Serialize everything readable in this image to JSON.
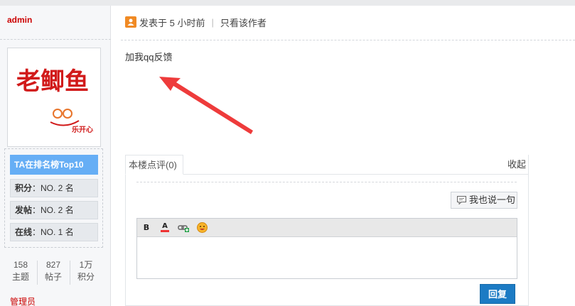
{
  "author": {
    "name": "admin",
    "role": "管理员"
  },
  "avatar": {
    "logo_text": "老鲫鱼",
    "sub_text": "乐开心"
  },
  "rank": {
    "title": "TA在排名榜Top10",
    "rows": [
      {
        "label": "积分",
        "value": "：NO. 2 名"
      },
      {
        "label": "发帖",
        "value": "：NO. 2 名"
      },
      {
        "label": "在线",
        "value": "：NO. 1 名"
      }
    ]
  },
  "stats": [
    {
      "value": "158",
      "label": "主题"
    },
    {
      "value": "827",
      "label": "帖子"
    },
    {
      "value": "1万",
      "label": "积分"
    }
  ],
  "post": {
    "posted_text": "发表于 5 小时前",
    "only_author": "只看该作者",
    "divider": "|",
    "content": "加我qq反馈"
  },
  "comments": {
    "tab_label": "本楼点评(0)",
    "collapse_label": "收起",
    "say_button": "我也说一句",
    "reply_button": "回复"
  },
  "colors": {
    "accent": "#1c7bc4",
    "rank_title": "#66aef5",
    "author": "#cc0000",
    "arrow": "#ee3b3b"
  }
}
